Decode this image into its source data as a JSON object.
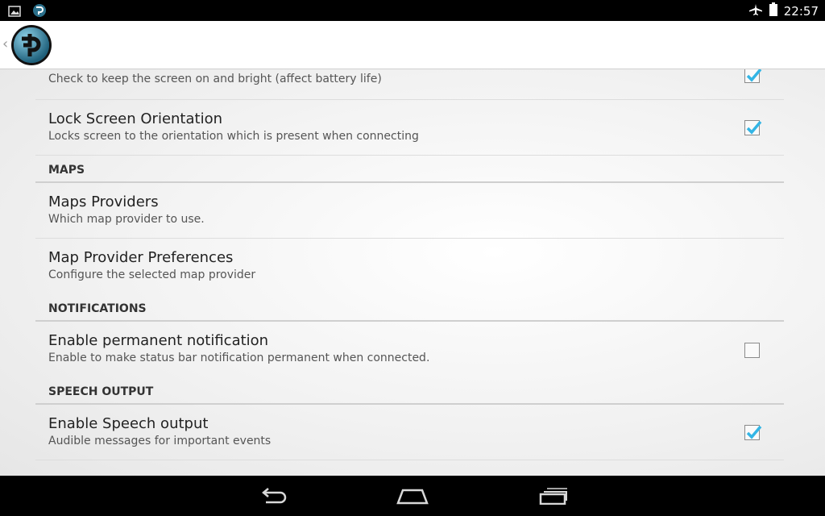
{
  "status_bar": {
    "time": "22:57",
    "left_icons": [
      "image-notification-icon",
      "app-notification-icon"
    ],
    "right_icons": [
      "airplane-mode-icon",
      "battery-icon"
    ]
  },
  "action_bar": {
    "up_caret": "‹",
    "logo_icon": "app-logo-icon"
  },
  "settings": {
    "keep_screen_on": {
      "summary": "Check to keep the screen on and bright (affect battery life)",
      "checked": true
    },
    "lock_orientation": {
      "title": "Lock Screen Orientation",
      "summary": "Locks screen to the orientation which is present when connecting",
      "checked": true
    },
    "maps_header": "MAPS",
    "maps_providers": {
      "title": "Maps Providers",
      "summary": "Which map provider to use."
    },
    "map_provider_prefs": {
      "title": "Map Provider Preferences",
      "summary": "Configure the selected map provider"
    },
    "notifications_header": "NOTIFICATIONS",
    "permanent_notification": {
      "title": "Enable permanent notification",
      "summary": "Enable to make status bar notification permanent when connected.",
      "checked": false
    },
    "speech_header": "SPEECH OUTPUT",
    "speech_output": {
      "title": "Enable Speech output",
      "summary": "Audible messages for important events",
      "checked": true
    }
  },
  "nav_bar": {
    "icons": [
      "back-icon",
      "home-icon",
      "recent-apps-icon"
    ]
  },
  "colors": {
    "accent": "#33b5e5",
    "action_bar": "#ffffff",
    "background": "#f2f2f2"
  }
}
